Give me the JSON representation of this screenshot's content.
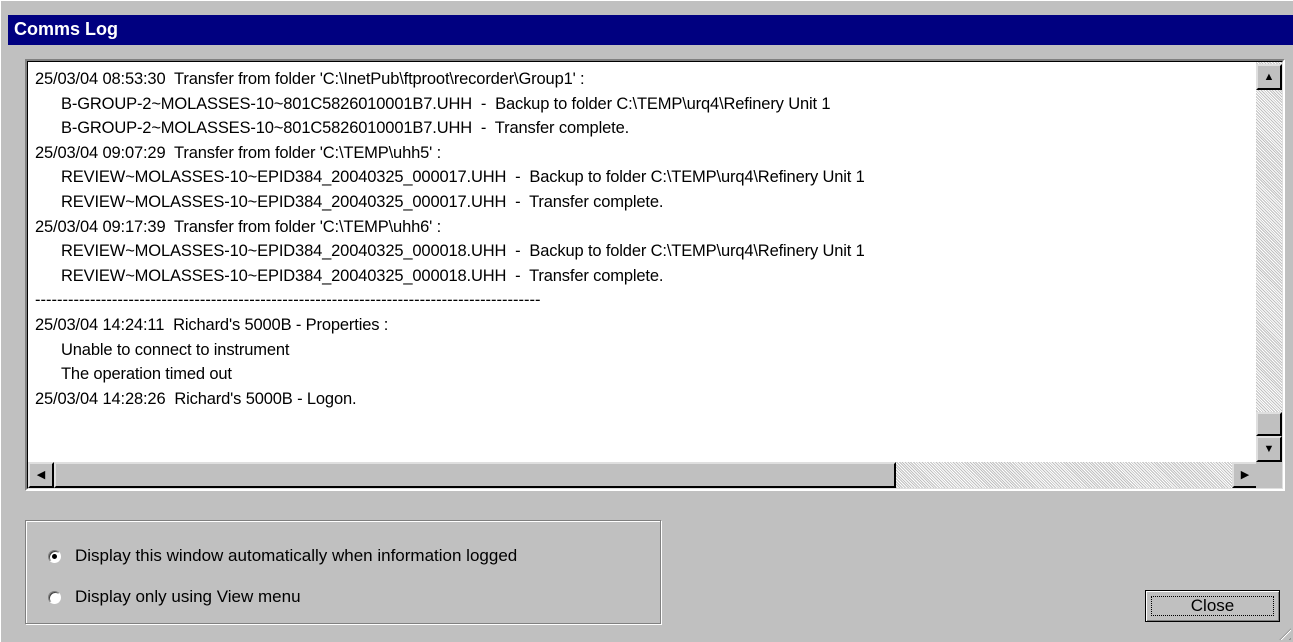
{
  "window": {
    "title": "Comms Log"
  },
  "log": {
    "lines": [
      {
        "text": "25/03/04 08:53:30  Transfer from folder 'C:\\InetPub\\ftproot\\recorder\\Group1' :",
        "indent": false
      },
      {
        "text": "B-GROUP-2~MOLASSES-10~801C5826010001B7.UHH  -  Backup to folder C:\\TEMP\\urq4\\Refinery Unit 1",
        "indent": true
      },
      {
        "text": "B-GROUP-2~MOLASSES-10~801C5826010001B7.UHH  -  Transfer complete.",
        "indent": true
      },
      {
        "text": "25/03/04 09:07:29  Transfer from folder 'C:\\TEMP\\uhh5' :",
        "indent": false
      },
      {
        "text": "REVIEW~MOLASSES-10~EPID384_20040325_000017.UHH  -  Backup to folder C:\\TEMP\\urq4\\Refinery Unit 1",
        "indent": true
      },
      {
        "text": "REVIEW~MOLASSES-10~EPID384_20040325_000017.UHH  -  Transfer complete.",
        "indent": true
      },
      {
        "text": "25/03/04 09:17:39  Transfer from folder 'C:\\TEMP\\uhh6' :",
        "indent": false
      },
      {
        "text": "REVIEW~MOLASSES-10~EPID384_20040325_000018.UHH  -  Backup to folder C:\\TEMP\\urq4\\Refinery Unit 1",
        "indent": true
      },
      {
        "text": "REVIEW~MOLASSES-10~EPID384_20040325_000018.UHH  -  Transfer complete.",
        "indent": true
      },
      {
        "text": "--------------------------------------------------------------------------------------------",
        "indent": false,
        "separator": true
      },
      {
        "text": "25/03/04 14:24:11  Richard's 5000B - Properties :",
        "indent": false
      },
      {
        "text": "Unable to connect to instrument",
        "indent": true
      },
      {
        "text": "The operation timed out",
        "indent": true
      },
      {
        "text": "25/03/04 14:28:26  Richard's 5000B - Logon.",
        "indent": false
      }
    ]
  },
  "scrollbar": {
    "up_glyph": "▲",
    "down_glyph": "▼",
    "left_glyph": "◀",
    "right_glyph": "▶"
  },
  "options": {
    "auto_label": "Display this window automatically when information logged",
    "menu_label": "Display only using View menu",
    "selected": "auto"
  },
  "close_label": "Close",
  "colors": {
    "titlebar": "#000080",
    "face": "#c0c0c0"
  }
}
